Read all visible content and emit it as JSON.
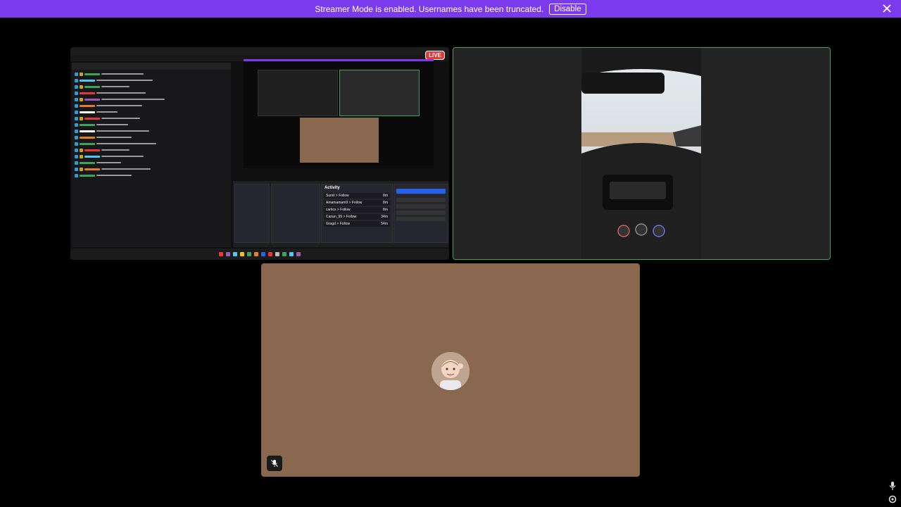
{
  "banner": {
    "message": "Streamer Mode is enabled. Usernames have been truncated.",
    "disable_label": "Disable"
  },
  "screen_share": {
    "live_label": "LIVE",
    "activity": {
      "title": "Activity",
      "rows": [
        {
          "user": "Sumil",
          "event": "Follow",
          "age": "8m"
        },
        {
          "user": "Amamamam9",
          "event": "Follow",
          "age": "8m"
        },
        {
          "user": "cartics",
          "event": "Follow",
          "age": "8m"
        },
        {
          "user": "Canan_99",
          "event": "Follow",
          "age": "34m"
        },
        {
          "user": "Gragd",
          "event": "Follow",
          "age": "54m"
        }
      ]
    }
  },
  "icons": {
    "banner_close": "close-icon",
    "mute": "mic-muted-icon",
    "mic": "mic-icon",
    "settings": "gear-icon"
  },
  "colors": {
    "banner_bg": "#7c3aed",
    "speaking_border": "#3ba55c",
    "avatar_tile_bg": "#8a6850",
    "live_red": "#e53935"
  }
}
